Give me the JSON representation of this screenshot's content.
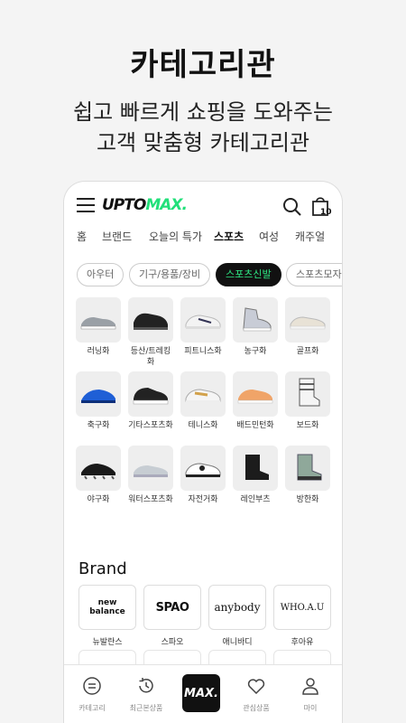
{
  "hero": {
    "title": "카테고리관",
    "subtitle_line1": "쉽고 빠르게 쇼핑을 도와주는",
    "subtitle_line2": "고객 맞춤형 카테고리관"
  },
  "header": {
    "logo_part1": "UPTO",
    "logo_part2": "MAX.",
    "cart_count": "10",
    "icons": [
      "menu-icon",
      "search-icon",
      "shopping-bag-icon"
    ]
  },
  "tabs": [
    {
      "label": "홈",
      "active": false
    },
    {
      "label": "브랜드",
      "active": false
    },
    {
      "label": "오늘의 특가",
      "active": false
    },
    {
      "label": "스포츠",
      "active": true
    },
    {
      "label": "여성",
      "active": false
    },
    {
      "label": "캐주얼",
      "active": false
    }
  ],
  "chips": [
    {
      "label": "아우터",
      "active": false
    },
    {
      "label": "기구/용품/장비",
      "active": false
    },
    {
      "label": "스포츠신발",
      "active": true
    },
    {
      "label": "스포츠모자",
      "active": false
    }
  ],
  "categories": [
    {
      "label": "러닝화"
    },
    {
      "label": "등산/트레킹화"
    },
    {
      "label": "피트니스화"
    },
    {
      "label": "농구화"
    },
    {
      "label": "골프화"
    },
    {
      "label": "축구화"
    },
    {
      "label": "기타스포츠화"
    },
    {
      "label": "테니스화"
    },
    {
      "label": "배드민턴화"
    },
    {
      "label": "보드화"
    },
    {
      "label": "야구화"
    },
    {
      "label": "워터스포츠화"
    },
    {
      "label": "자전거화"
    },
    {
      "label": "레인부츠"
    },
    {
      "label": "방한화"
    }
  ],
  "brand_section": {
    "title": "Brand",
    "brands": [
      {
        "logo_text": "new balance",
        "label": "뉴발란스"
      },
      {
        "logo_text": "SPAO",
        "label": "스파오"
      },
      {
        "logo_text": "anybody",
        "label": "애니바디"
      },
      {
        "logo_text": "WHO.A.U",
        "label": "후아유"
      }
    ]
  },
  "bottom_nav": {
    "items": [
      {
        "label": "카테고리",
        "icon": "category-icon"
      },
      {
        "label": "최근본상품",
        "icon": "history-icon"
      },
      {
        "label": "MAX.",
        "icon": "home-logo"
      },
      {
        "label": "관심상품",
        "icon": "heart-icon"
      },
      {
        "label": "마이",
        "icon": "user-icon"
      }
    ]
  },
  "colors": {
    "accent": "#22e07a",
    "dark": "#111111"
  }
}
